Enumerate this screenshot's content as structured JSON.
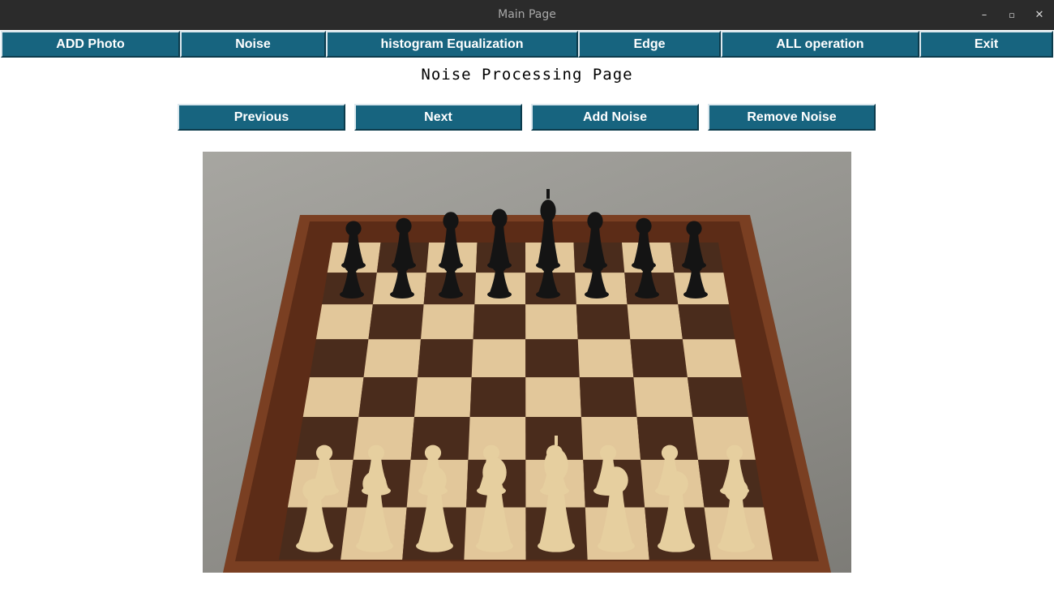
{
  "window": {
    "title": "Main Page",
    "minimize_glyph": "–",
    "maximize_glyph": "▫",
    "close_glyph": "✕"
  },
  "menu": {
    "items": [
      {
        "label": "ADD Photo"
      },
      {
        "label": "Noise"
      },
      {
        "label": "histogram Equalization"
      },
      {
        "label": "Edge"
      },
      {
        "label": "ALL operation"
      },
      {
        "label": "Exit"
      }
    ]
  },
  "page": {
    "heading": "Noise Processing Page"
  },
  "actions": {
    "previous": "Previous",
    "next": "Next",
    "add_noise": "Add Noise",
    "remove_noise": "Remove Noise"
  },
  "image": {
    "subject": "chessboard-photo",
    "colors": {
      "board_frame": "#7a3f22",
      "light_square": "#e2c79a",
      "dark_square": "#4a2c1c",
      "background": "#9c9b96",
      "black_piece": "#141414",
      "white_piece": "#e6cf9f"
    }
  },
  "colors": {
    "button_bg": "#17647f",
    "titlebar_bg": "#2b2b2b"
  }
}
